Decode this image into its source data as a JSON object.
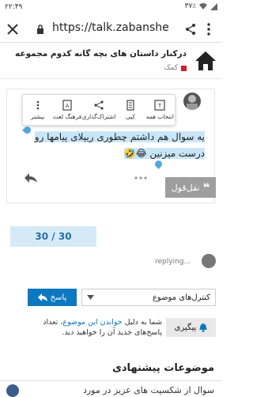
{
  "status": {
    "time": "۲۲:۴۹",
    "battery": "٣٧٪"
  },
  "browser": {
    "url": "https://talk.zabanshe"
  },
  "topic": {
    "title": "درکنار داستان های بچه گانه کدوم مجموعه رو پ .",
    "category": "کمک"
  },
  "popup": {
    "items": [
      {
        "label": "انتخاب همه"
      },
      {
        "label": "کپی"
      },
      {
        "label": "اشتراک‌گذاری"
      },
      {
        "label": "فرهنگ لغت"
      },
      {
        "label": "بیشتر"
      }
    ]
  },
  "post": {
    "text": "یه سوال هم داشتم چطوری ریپلای پیامها رو درست میزنین 😂🤣"
  },
  "quote": {
    "label": "نقل‌قول"
  },
  "progress": {
    "value": "30 / 30"
  },
  "replying": {
    "text": "replying..."
  },
  "controls": {
    "topic_controls": "کنترل‌های موضوع",
    "reply": "پاسخ"
  },
  "tracking": {
    "button": "پیگیری",
    "text_pre": "شما به دلیل ",
    "link": "خواندن این موضوع",
    "text_post": "، تعداد پاسخ‌های جدید آن را خواهید دید."
  },
  "suggested": {
    "title": "موضوعات پیشنهادی",
    "first": "سوال از شکسپت های عزیز در مورد"
  }
}
